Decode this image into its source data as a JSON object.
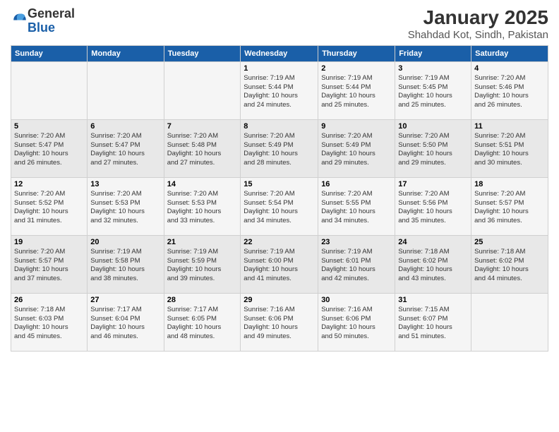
{
  "logo": {
    "general": "General",
    "blue": "Blue"
  },
  "title": "January 2025",
  "subtitle": "Shahdad Kot, Sindh, Pakistan",
  "weekdays": [
    "Sunday",
    "Monday",
    "Tuesday",
    "Wednesday",
    "Thursday",
    "Friday",
    "Saturday"
  ],
  "weeks": [
    [
      {
        "day": "",
        "info": ""
      },
      {
        "day": "",
        "info": ""
      },
      {
        "day": "",
        "info": ""
      },
      {
        "day": "1",
        "info": "Sunrise: 7:19 AM\nSunset: 5:44 PM\nDaylight: 10 hours\nand 24 minutes."
      },
      {
        "day": "2",
        "info": "Sunrise: 7:19 AM\nSunset: 5:44 PM\nDaylight: 10 hours\nand 25 minutes."
      },
      {
        "day": "3",
        "info": "Sunrise: 7:19 AM\nSunset: 5:45 PM\nDaylight: 10 hours\nand 25 minutes."
      },
      {
        "day": "4",
        "info": "Sunrise: 7:20 AM\nSunset: 5:46 PM\nDaylight: 10 hours\nand 26 minutes."
      }
    ],
    [
      {
        "day": "5",
        "info": "Sunrise: 7:20 AM\nSunset: 5:47 PM\nDaylight: 10 hours\nand 26 minutes."
      },
      {
        "day": "6",
        "info": "Sunrise: 7:20 AM\nSunset: 5:47 PM\nDaylight: 10 hours\nand 27 minutes."
      },
      {
        "day": "7",
        "info": "Sunrise: 7:20 AM\nSunset: 5:48 PM\nDaylight: 10 hours\nand 27 minutes."
      },
      {
        "day": "8",
        "info": "Sunrise: 7:20 AM\nSunset: 5:49 PM\nDaylight: 10 hours\nand 28 minutes."
      },
      {
        "day": "9",
        "info": "Sunrise: 7:20 AM\nSunset: 5:49 PM\nDaylight: 10 hours\nand 29 minutes."
      },
      {
        "day": "10",
        "info": "Sunrise: 7:20 AM\nSunset: 5:50 PM\nDaylight: 10 hours\nand 29 minutes."
      },
      {
        "day": "11",
        "info": "Sunrise: 7:20 AM\nSunset: 5:51 PM\nDaylight: 10 hours\nand 30 minutes."
      }
    ],
    [
      {
        "day": "12",
        "info": "Sunrise: 7:20 AM\nSunset: 5:52 PM\nDaylight: 10 hours\nand 31 minutes."
      },
      {
        "day": "13",
        "info": "Sunrise: 7:20 AM\nSunset: 5:53 PM\nDaylight: 10 hours\nand 32 minutes."
      },
      {
        "day": "14",
        "info": "Sunrise: 7:20 AM\nSunset: 5:53 PM\nDaylight: 10 hours\nand 33 minutes."
      },
      {
        "day": "15",
        "info": "Sunrise: 7:20 AM\nSunset: 5:54 PM\nDaylight: 10 hours\nand 34 minutes."
      },
      {
        "day": "16",
        "info": "Sunrise: 7:20 AM\nSunset: 5:55 PM\nDaylight: 10 hours\nand 34 minutes."
      },
      {
        "day": "17",
        "info": "Sunrise: 7:20 AM\nSunset: 5:56 PM\nDaylight: 10 hours\nand 35 minutes."
      },
      {
        "day": "18",
        "info": "Sunrise: 7:20 AM\nSunset: 5:57 PM\nDaylight: 10 hours\nand 36 minutes."
      }
    ],
    [
      {
        "day": "19",
        "info": "Sunrise: 7:20 AM\nSunset: 5:57 PM\nDaylight: 10 hours\nand 37 minutes."
      },
      {
        "day": "20",
        "info": "Sunrise: 7:19 AM\nSunset: 5:58 PM\nDaylight: 10 hours\nand 38 minutes."
      },
      {
        "day": "21",
        "info": "Sunrise: 7:19 AM\nSunset: 5:59 PM\nDaylight: 10 hours\nand 39 minutes."
      },
      {
        "day": "22",
        "info": "Sunrise: 7:19 AM\nSunset: 6:00 PM\nDaylight: 10 hours\nand 41 minutes."
      },
      {
        "day": "23",
        "info": "Sunrise: 7:19 AM\nSunset: 6:01 PM\nDaylight: 10 hours\nand 42 minutes."
      },
      {
        "day": "24",
        "info": "Sunrise: 7:18 AM\nSunset: 6:02 PM\nDaylight: 10 hours\nand 43 minutes."
      },
      {
        "day": "25",
        "info": "Sunrise: 7:18 AM\nSunset: 6:02 PM\nDaylight: 10 hours\nand 44 minutes."
      }
    ],
    [
      {
        "day": "26",
        "info": "Sunrise: 7:18 AM\nSunset: 6:03 PM\nDaylight: 10 hours\nand 45 minutes."
      },
      {
        "day": "27",
        "info": "Sunrise: 7:17 AM\nSunset: 6:04 PM\nDaylight: 10 hours\nand 46 minutes."
      },
      {
        "day": "28",
        "info": "Sunrise: 7:17 AM\nSunset: 6:05 PM\nDaylight: 10 hours\nand 48 minutes."
      },
      {
        "day": "29",
        "info": "Sunrise: 7:16 AM\nSunset: 6:06 PM\nDaylight: 10 hours\nand 49 minutes."
      },
      {
        "day": "30",
        "info": "Sunrise: 7:16 AM\nSunset: 6:06 PM\nDaylight: 10 hours\nand 50 minutes."
      },
      {
        "day": "31",
        "info": "Sunrise: 7:15 AM\nSunset: 6:07 PM\nDaylight: 10 hours\nand 51 minutes."
      },
      {
        "day": "",
        "info": ""
      }
    ]
  ]
}
